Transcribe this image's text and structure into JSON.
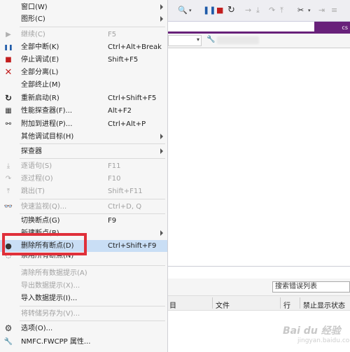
{
  "toolbar": {
    "search_text": "搜索错误列表",
    "tab_label": "cs"
  },
  "error_list": {
    "columns": [
      "目",
      "文件",
      "行",
      "禁止显示状态"
    ]
  },
  "watermark": {
    "text": "Bai du 经验",
    "sub": "jingyan.baidu.com"
  },
  "menu": {
    "items": [
      {
        "label": "窗口(W)",
        "shortcut": "",
        "icon": "",
        "submenu": true,
        "disabled": false
      },
      {
        "label": "图形(C)",
        "shortcut": "",
        "icon": "",
        "submenu": true,
        "disabled": false
      },
      {
        "label": "继续(C)",
        "shortcut": "F5",
        "icon": "continue-icon",
        "submenu": false,
        "disabled": true
      },
      {
        "label": "全部中断(K)",
        "shortcut": "Ctrl+Alt+Break",
        "icon": "pause-icon",
        "submenu": false,
        "disabled": false
      },
      {
        "label": "停止调试(E)",
        "shortcut": "Shift+F5",
        "icon": "stop-icon",
        "submenu": false,
        "disabled": false
      },
      {
        "label": "全部分离(L)",
        "shortcut": "",
        "icon": "detach-icon",
        "submenu": false,
        "disabled": false
      },
      {
        "label": "全部终止(M)",
        "shortcut": "",
        "icon": "",
        "submenu": false,
        "disabled": false
      },
      {
        "label": "重新启动(R)",
        "shortcut": "Ctrl+Shift+F5",
        "icon": "restart-icon",
        "submenu": false,
        "disabled": false
      },
      {
        "label": "性能探查器(F)...",
        "shortcut": "Alt+F2",
        "icon": "profiler-icon",
        "submenu": false,
        "disabled": false
      },
      {
        "label": "附加到进程(P)...",
        "shortcut": "Ctrl+Alt+P",
        "icon": "attach-icon",
        "submenu": false,
        "disabled": false
      },
      {
        "label": "其他调试目标(H)",
        "shortcut": "",
        "icon": "",
        "submenu": true,
        "disabled": false
      },
      {
        "label": "探查器",
        "shortcut": "",
        "icon": "",
        "submenu": true,
        "disabled": false
      },
      {
        "label": "逐语句(S)",
        "shortcut": "F11",
        "icon": "step-into-icon",
        "submenu": false,
        "disabled": true
      },
      {
        "label": "逐过程(O)",
        "shortcut": "F10",
        "icon": "step-over-icon",
        "submenu": false,
        "disabled": true
      },
      {
        "label": "跳出(T)",
        "shortcut": "Shift+F11",
        "icon": "step-out-icon",
        "submenu": false,
        "disabled": true
      },
      {
        "label": "快速监视(Q)...",
        "shortcut": "Ctrl+D, Q",
        "icon": "quickwatch-icon",
        "submenu": false,
        "disabled": true
      },
      {
        "label": "切换断点(G)",
        "shortcut": "F9",
        "icon": "",
        "submenu": false,
        "disabled": false
      },
      {
        "label": "新建断点(B)",
        "shortcut": "",
        "icon": "",
        "submenu": true,
        "disabled": false
      },
      {
        "label": "删除所有断点(D)",
        "shortcut": "Ctrl+Shift+F9",
        "icon": "delete-breakpoints-icon",
        "submenu": false,
        "disabled": false,
        "highlighted": true
      },
      {
        "label": "禁用所有断点(N)",
        "shortcut": "",
        "icon": "disable-breakpoints-icon",
        "submenu": false,
        "disabled": false
      },
      {
        "label": "清除所有数据提示(A)",
        "shortcut": "",
        "icon": "",
        "submenu": false,
        "disabled": true
      },
      {
        "label": "导出数据提示(X)...",
        "shortcut": "",
        "icon": "",
        "submenu": false,
        "disabled": true
      },
      {
        "label": "导入数据提示(I)...",
        "shortcut": "",
        "icon": "",
        "submenu": false,
        "disabled": false
      },
      {
        "label": "将转储另存为(V)...",
        "shortcut": "",
        "icon": "",
        "submenu": false,
        "disabled": true
      },
      {
        "label": "选项(O)...",
        "shortcut": "",
        "icon": "gear-icon",
        "submenu": false,
        "disabled": false
      },
      {
        "label": "NMFC.FWCPP 属性...",
        "shortcut": "",
        "icon": "wrench-icon",
        "submenu": false,
        "disabled": false
      }
    ]
  }
}
